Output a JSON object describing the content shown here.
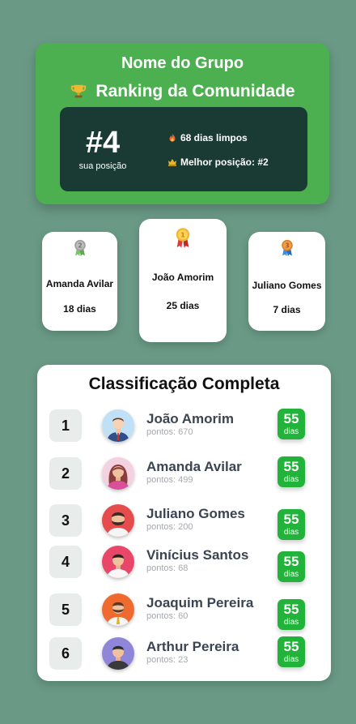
{
  "header": {
    "group_name": "Nome do Grupo",
    "ranking_title": "Ranking da Comunidade",
    "my_rank": "#4",
    "my_rank_label": "sua posição",
    "clean_days": "68 dias limpos",
    "best_position": "Melhor posição: #2"
  },
  "podium": {
    "first": {
      "medal": "1",
      "name": "João Amorim",
      "days": "25 dias"
    },
    "second": {
      "medal": "2",
      "name": "Amanda Avilar",
      "days": "18 dias"
    },
    "third": {
      "medal": "3",
      "name": "Juliano Gomes",
      "days": "7 dias"
    }
  },
  "full_ranking": {
    "title": "Classificação Completa",
    "days_label": "dias",
    "rows": [
      {
        "rank": "1",
        "name": "João Amorim",
        "points": "pontos: 670",
        "days": "55"
      },
      {
        "rank": "2",
        "name": "Amanda Avilar",
        "points": "pontos: 499",
        "days": "55"
      },
      {
        "rank": "3",
        "name": "Juliano Gomes",
        "points": "pontos: 200",
        "days": "55"
      },
      {
        "rank": "4",
        "name": "Vinícius Santos",
        "points": "pontos: 68",
        "days": "55"
      },
      {
        "rank": "5",
        "name": "Joaquim Pereira",
        "points": "pontos: 60",
        "days": "55"
      },
      {
        "rank": "6",
        "name": "Arthur Pereira",
        "points": "pontos: 23",
        "days": "55"
      }
    ]
  },
  "colors": {
    "page_background": "#6a9a86",
    "header_green": "#4caf50",
    "dark_panel": "#1a3b33",
    "badge_green": "#22b33a",
    "gold": "#f2b632",
    "silver": "#9e9e9e",
    "bronze": "#d9822b"
  },
  "icons": {
    "trophy": "trophy-icon",
    "fire": "fire-icon",
    "crown": "crown-icon",
    "medal_gold": "gold-medal-icon",
    "medal_silver": "silver-medal-icon",
    "medal_bronze": "bronze-medal-icon"
  }
}
